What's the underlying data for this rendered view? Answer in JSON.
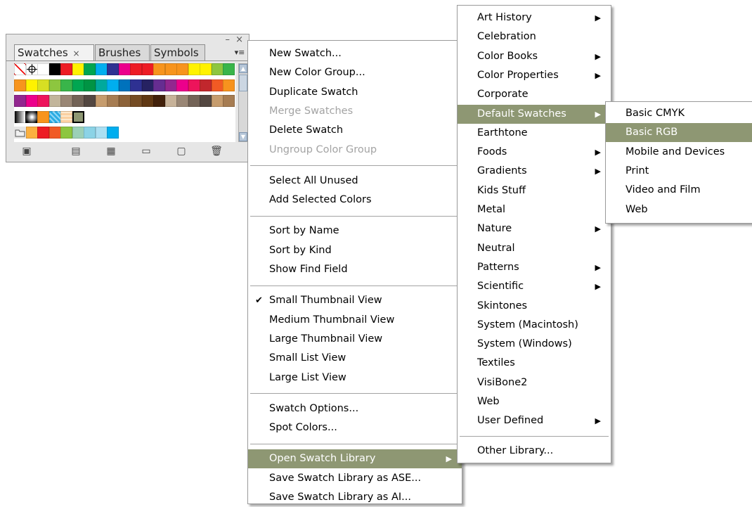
{
  "panel": {
    "tabs": [
      {
        "label": "Swatches",
        "active": true
      },
      {
        "label": "Brushes",
        "active": false
      },
      {
        "label": "Symbols",
        "active": false
      }
    ],
    "tab_close_glyph": "×",
    "window_buttons": "– ×",
    "menu_button": "▾≡",
    "swatch_rows": [
      [
        "none",
        "registration",
        "#ffffff",
        "#000000",
        "#ed1c24",
        "#fff200",
        "#00a651",
        "#00aeef",
        "#2e3192",
        "#ec008c",
        "#ed1c24",
        "#ed1c24",
        "#f7941d",
        "#f7941d",
        "#f7941d",
        "#fff200",
        "#fff200",
        "#8dc63f",
        "#39b54a"
      ],
      [
        "#f7941d",
        "#fff200",
        "#d7df23",
        "#8dc63f",
        "#39b54a",
        "#00a651",
        "#009444",
        "#00a99d",
        "#00aeef",
        "#0072bc",
        "#2e3192",
        "#262262",
        "#662d91",
        "#92278f",
        "#ec008c",
        "#ed145b",
        "#c1272d",
        "#f15a24",
        "#f7931e"
      ],
      [
        "#92278f",
        "#ec008c",
        "#ed145b",
        "#c2b59b",
        "#998675",
        "#736357",
        "#534741",
        "#c69c6d",
        "#a67c52",
        "#8c6239",
        "#754c24",
        "#603813",
        "#42210b",
        "#c7b299",
        "#998675",
        "#736357",
        "#534741",
        "#c69c6d",
        "#a67c52"
      ],
      [
        "gradient-black",
        "gradient-radial",
        "#f7941d",
        "pattern-blue",
        "pattern-peach",
        "selected-green",
        "",
        "",
        "",
        "",
        "",
        "",
        "",
        "",
        "",
        "",
        "",
        "",
        ""
      ],
      [
        "folder",
        "#fbb040",
        "#ed1c24",
        "#f15a24",
        "#8dc63f",
        "#9bd0b7",
        "#8bd3e6",
        "#abdff2",
        "#00aeef",
        "",
        "",
        "",
        "",
        "",
        "",
        "",
        "",
        "",
        ""
      ]
    ],
    "toolbar_icons": [
      "swatch-libraries-menu-icon",
      "show-swatch-kinds-icon",
      "swatch-options-icon",
      "new-color-group-icon",
      "new-swatch-icon",
      "delete-swatch-icon"
    ]
  },
  "menu1": {
    "groups": [
      [
        {
          "label": "New Swatch...",
          "disabled": false
        },
        {
          "label": "New Color Group...",
          "disabled": false
        },
        {
          "label": "Duplicate Swatch",
          "disabled": false
        },
        {
          "label": "Merge Swatches",
          "disabled": true
        },
        {
          "label": "Delete Swatch",
          "disabled": false
        },
        {
          "label": "Ungroup Color Group",
          "disabled": true
        }
      ],
      [
        {
          "label": "Select All Unused",
          "disabled": false
        },
        {
          "label": "Add Selected Colors",
          "disabled": false
        }
      ],
      [
        {
          "label": "Sort by Name",
          "disabled": false
        },
        {
          "label": "Sort by Kind",
          "disabled": false
        },
        {
          "label": "Show Find Field",
          "disabled": false
        }
      ],
      [
        {
          "label": "Small Thumbnail View",
          "disabled": false,
          "checked": true
        },
        {
          "label": "Medium Thumbnail View",
          "disabled": false
        },
        {
          "label": "Large Thumbnail View",
          "disabled": false
        },
        {
          "label": "Small List View",
          "disabled": false
        },
        {
          "label": "Large List View",
          "disabled": false
        }
      ],
      [
        {
          "label": "Swatch Options...",
          "disabled": false
        },
        {
          "label": "Spot Colors...",
          "disabled": false
        }
      ],
      [
        {
          "label": "Open Swatch Library",
          "disabled": false,
          "highlighted": true,
          "submenu": true
        },
        {
          "label": "Save Swatch Library as ASE...",
          "disabled": false
        },
        {
          "label": "Save Swatch Library as AI...",
          "disabled": false
        }
      ]
    ]
  },
  "menu2": {
    "groups": [
      [
        {
          "label": "Art History",
          "submenu": true
        },
        {
          "label": "Celebration"
        },
        {
          "label": "Color Books",
          "submenu": true
        },
        {
          "label": "Color Properties",
          "submenu": true
        },
        {
          "label": "Corporate"
        },
        {
          "label": "Default Swatches",
          "submenu": true,
          "highlighted": true
        },
        {
          "label": "Earthtone"
        },
        {
          "label": "Foods",
          "submenu": true
        },
        {
          "label": "Gradients",
          "submenu": true
        },
        {
          "label": "Kids Stuff"
        },
        {
          "label": "Metal"
        },
        {
          "label": "Nature",
          "submenu": true
        },
        {
          "label": "Neutral"
        },
        {
          "label": "Patterns",
          "submenu": true
        },
        {
          "label": "Scientific",
          "submenu": true
        },
        {
          "label": "Skintones"
        },
        {
          "label": "System (Macintosh)"
        },
        {
          "label": "System (Windows)"
        },
        {
          "label": "Textiles"
        },
        {
          "label": "VisiBone2"
        },
        {
          "label": "Web"
        },
        {
          "label": "User Defined",
          "submenu": true
        }
      ],
      [
        {
          "label": "Other Library..."
        }
      ]
    ]
  },
  "menu3": {
    "groups": [
      [
        {
          "label": "Basic CMYK"
        },
        {
          "label": "Basic RGB",
          "highlighted": true
        },
        {
          "label": "Mobile and Devices"
        },
        {
          "label": "Print"
        },
        {
          "label": "Video and Film"
        },
        {
          "label": "Web"
        }
      ]
    ]
  },
  "colors": {
    "highlight": "#8e9773",
    "disabled_text": "#a3a3a3",
    "panel_bg": "#e6e6e6"
  },
  "glyphs": {
    "submenu_arrow": "▶",
    "check": "✔"
  }
}
